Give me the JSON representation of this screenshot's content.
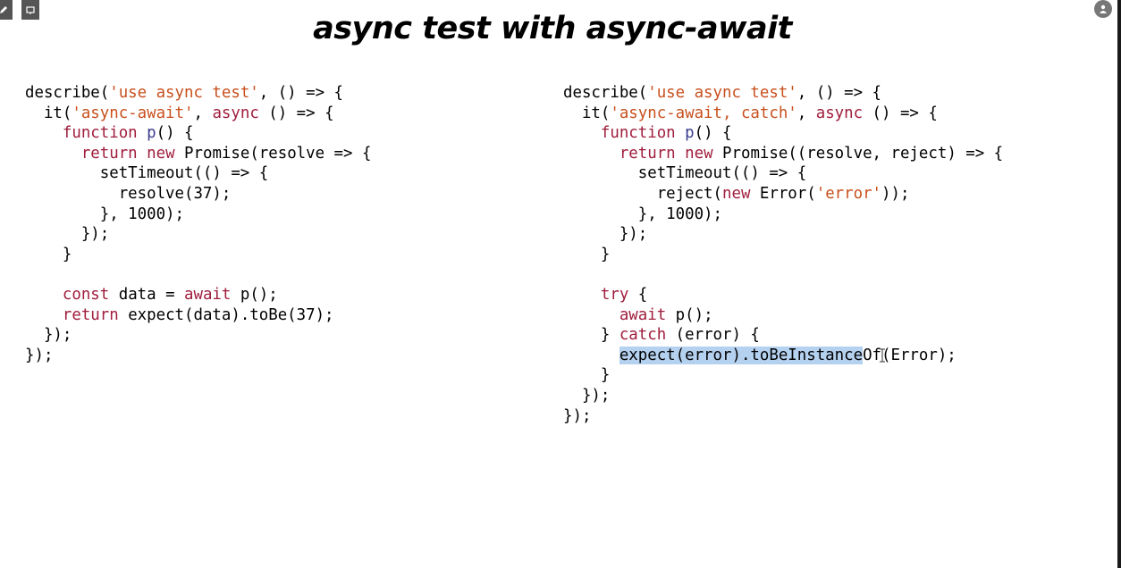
{
  "slide": {
    "title": "async test with async-await"
  },
  "toolbar": {
    "edit_icon": "pencil-icon",
    "slide_icon": "slide-view-icon",
    "presenter_icon": "presenter-icon"
  },
  "colors": {
    "keyword": "#a01d3c",
    "string": "#c8501e",
    "function_name": "#3a3a8c",
    "selection": "#b5d1f0"
  },
  "code_left": {
    "lines": [
      [
        {
          "t": "describe("
        },
        {
          "t": "'use async test'",
          "c": "str"
        },
        {
          "t": ", () => {"
        }
      ],
      [
        {
          "t": "  it("
        },
        {
          "t": "'async-await'",
          "c": "str"
        },
        {
          "t": ", "
        },
        {
          "t": "async",
          "c": "kw"
        },
        {
          "t": " () => {"
        }
      ],
      [
        {
          "t": "    "
        },
        {
          "t": "function",
          "c": "kw"
        },
        {
          "t": " "
        },
        {
          "t": "p",
          "c": "fn"
        },
        {
          "t": "() {"
        }
      ],
      [
        {
          "t": "      "
        },
        {
          "t": "return",
          "c": "kw"
        },
        {
          "t": " "
        },
        {
          "t": "new",
          "c": "kw"
        },
        {
          "t": " Promise(resolve => {"
        }
      ],
      [
        {
          "t": "        setTimeout(() => {"
        }
      ],
      [
        {
          "t": "          resolve(37);"
        }
      ],
      [
        {
          "t": "        }, 1000);"
        }
      ],
      [
        {
          "t": "      });"
        }
      ],
      [
        {
          "t": "    }"
        }
      ],
      [
        {
          "t": ""
        }
      ],
      [
        {
          "t": "    "
        },
        {
          "t": "const",
          "c": "kw"
        },
        {
          "t": " data = "
        },
        {
          "t": "await",
          "c": "kw"
        },
        {
          "t": " p();"
        }
      ],
      [
        {
          "t": "    "
        },
        {
          "t": "return",
          "c": "kw"
        },
        {
          "t": " expect(data).toBe(37);"
        }
      ],
      [
        {
          "t": "  });"
        }
      ],
      [
        {
          "t": "});"
        }
      ]
    ]
  },
  "code_right": {
    "lines": [
      [
        {
          "t": "describe("
        },
        {
          "t": "'use async test'",
          "c": "str"
        },
        {
          "t": ", () => {"
        }
      ],
      [
        {
          "t": "  it("
        },
        {
          "t": "'async-await, catch'",
          "c": "str"
        },
        {
          "t": ", "
        },
        {
          "t": "async",
          "c": "kw"
        },
        {
          "t": " () => {"
        }
      ],
      [
        {
          "t": "    "
        },
        {
          "t": "function",
          "c": "kw"
        },
        {
          "t": " "
        },
        {
          "t": "p",
          "c": "fn"
        },
        {
          "t": "() {"
        }
      ],
      [
        {
          "t": "      "
        },
        {
          "t": "return",
          "c": "kw"
        },
        {
          "t": " "
        },
        {
          "t": "new",
          "c": "kw"
        },
        {
          "t": " Promise((resolve, reject) => {"
        }
      ],
      [
        {
          "t": "        setTimeout(() => {"
        }
      ],
      [
        {
          "t": "          reject("
        },
        {
          "t": "new",
          "c": "kw"
        },
        {
          "t": " Error("
        },
        {
          "t": "'error'",
          "c": "str"
        },
        {
          "t": "));"
        }
      ],
      [
        {
          "t": "        }, 1000);"
        }
      ],
      [
        {
          "t": "      });"
        }
      ],
      [
        {
          "t": "    }"
        }
      ],
      [
        {
          "t": ""
        }
      ],
      [
        {
          "t": "    "
        },
        {
          "t": "try",
          "c": "kw"
        },
        {
          "t": " {"
        }
      ],
      [
        {
          "t": "      "
        },
        {
          "t": "await",
          "c": "kw"
        },
        {
          "t": " p();"
        }
      ],
      [
        {
          "t": "    } "
        },
        {
          "t": "catch",
          "c": "kw"
        },
        {
          "t": " (error) {"
        }
      ],
      [
        {
          "t": "      "
        },
        {
          "t": "expect(error).toBeInstance",
          "c": "sel"
        },
        {
          "t": "Of(Error);"
        }
      ],
      [
        {
          "t": "    }"
        }
      ],
      [
        {
          "t": "  });"
        }
      ],
      [
        {
          "t": "});"
        }
      ]
    ]
  }
}
